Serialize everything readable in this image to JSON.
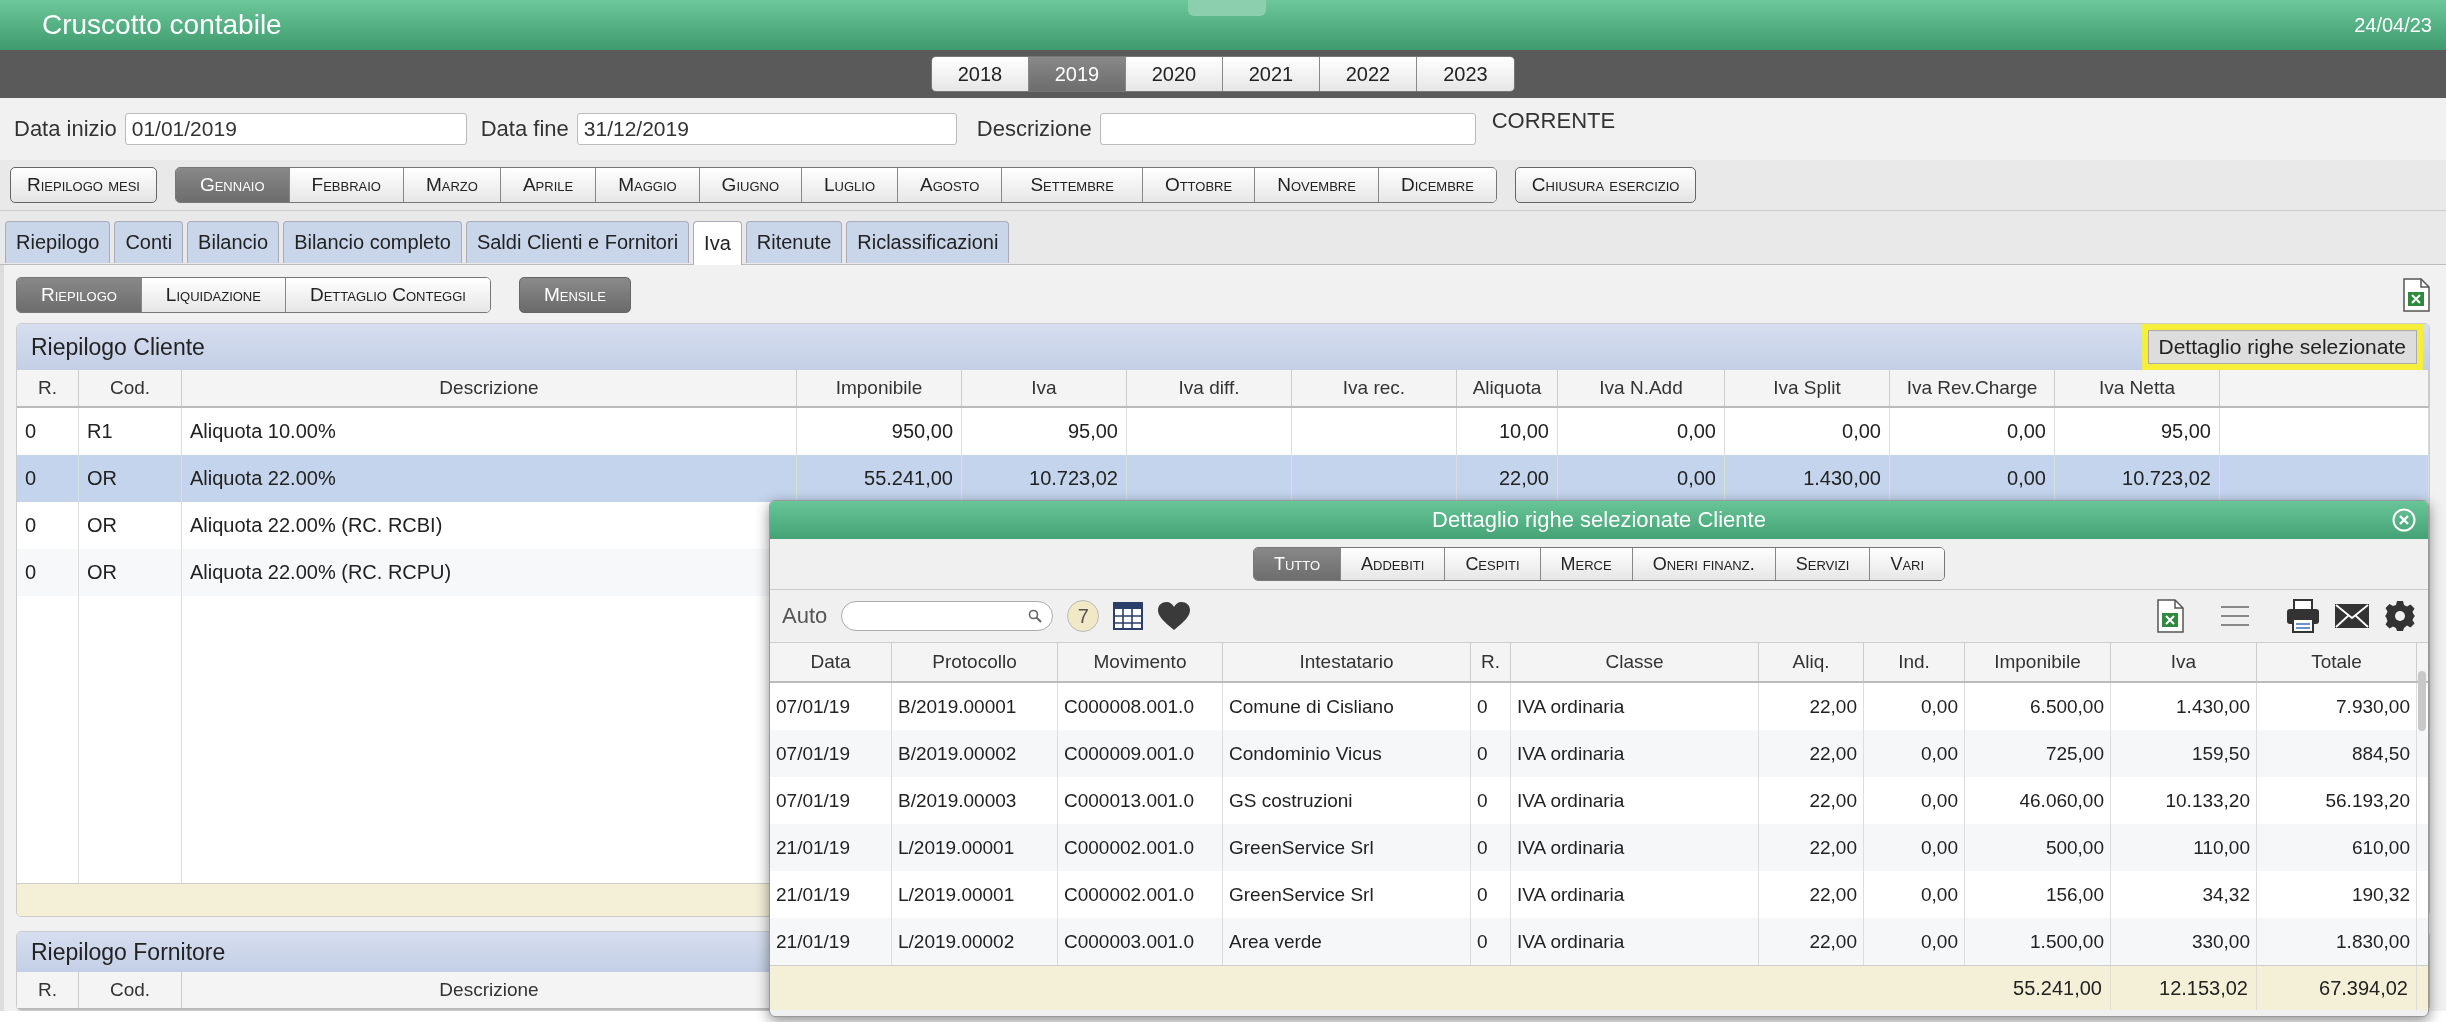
{
  "window": {
    "title": "Cruscotto contabile",
    "date": "24/04/23"
  },
  "years": [
    {
      "label": "2018",
      "selected": false
    },
    {
      "label": "2019",
      "selected": true
    },
    {
      "label": "2020",
      "selected": false
    },
    {
      "label": "2021",
      "selected": false
    },
    {
      "label": "2022",
      "selected": false
    },
    {
      "label": "2023",
      "selected": false
    }
  ],
  "period": {
    "start_label": "Data inizio",
    "start": "01/01/2019",
    "end_label": "Data fine",
    "end": "31/12/2019",
    "description_label": "Descrizione",
    "status": "CORRENTE"
  },
  "months": {
    "summary": "Riepilogo mesi",
    "items": [
      {
        "label": "Gennaio",
        "selected": true
      },
      {
        "label": "Febbraio",
        "selected": false
      },
      {
        "label": "Marzo",
        "selected": false
      },
      {
        "label": "Aprile",
        "selected": false
      },
      {
        "label": "Maggio",
        "selected": false
      },
      {
        "label": "Giugno",
        "selected": false
      },
      {
        "label": "Luglio",
        "selected": false
      },
      {
        "label": "Agosto",
        "selected": false
      },
      {
        "label": "Settembre",
        "selected": false
      },
      {
        "label": "Ottobre",
        "selected": false
      },
      {
        "label": "Novembre",
        "selected": false
      },
      {
        "label": "Dicembre",
        "selected": false
      }
    ],
    "closing": "Chiusura esercizio"
  },
  "tabs": [
    {
      "label": "Riepilogo",
      "selected": false
    },
    {
      "label": "Conti",
      "selected": false
    },
    {
      "label": "Bilancio",
      "selected": false
    },
    {
      "label": "Bilancio completo",
      "selected": false
    },
    {
      "label": "Saldi Clienti e Fornitori",
      "selected": false
    },
    {
      "label": "Iva",
      "selected": true
    },
    {
      "label": "Ritenute",
      "selected": false
    },
    {
      "label": "Riclassificazioni",
      "selected": false
    }
  ],
  "subtabs": [
    {
      "label": "Riepilogo",
      "selected": true
    },
    {
      "label": "Liquidazione",
      "selected": false
    },
    {
      "label": "Dettaglio Conteggi",
      "selected": false
    }
  ],
  "period_mode": {
    "label": "Mensile",
    "on": true
  },
  "customer_summary": {
    "title": "Riepilogo Cliente",
    "detail_button": {
      "label": "Dettaglio righe selezionate",
      "highlighted": true
    },
    "columns": [
      "R.",
      "Cod.",
      "Descrizione",
      "Imponibile",
      "Iva",
      "Iva diff.",
      "Iva rec.",
      "Aliquota",
      "Iva N.Add",
      "Iva Split",
      "Iva Rev.Charge",
      "Iva Netta"
    ],
    "rows": [
      {
        "selected": false,
        "cells": [
          "0",
          "R1",
          "Aliquota 10.00%",
          "950,00",
          "95,00",
          "",
          "",
          "10,00",
          "0,00",
          "0,00",
          "0,00",
          "95,00"
        ]
      },
      {
        "selected": true,
        "cells": [
          "0",
          "OR",
          "Aliquota 22.00%",
          "55.241,00",
          "10.723,02",
          "",
          "",
          "22,00",
          "0,00",
          "1.430,00",
          "0,00",
          "10.723,02"
        ]
      },
      {
        "selected": false,
        "cells": [
          "0",
          "OR",
          "Aliquota 22.00% (RC. RCBI)"
        ]
      },
      {
        "selected": false,
        "cells": [
          "0",
          "OR",
          "Aliquota 22.00% (RC. RCPU)"
        ]
      }
    ]
  },
  "supplier_summary": {
    "title": "Riepilogo Fornitore",
    "columns": [
      "R.",
      "Cod.",
      "Descrizione"
    ]
  },
  "detail_dialog": {
    "title": "Dettaglio righe selezionate Cliente",
    "filters": [
      {
        "label": "Tutto",
        "selected": true
      },
      {
        "label": "Addebiti",
        "selected": false
      },
      {
        "label": "Cespiti",
        "selected": false
      },
      {
        "label": "Merce",
        "selected": false
      },
      {
        "label": "Oneri finanz.",
        "selected": false
      },
      {
        "label": "Servizi",
        "selected": false
      },
      {
        "label": "Vari",
        "selected": false
      }
    ],
    "search_label": "Auto",
    "count": "7",
    "columns": [
      "Data",
      "Protocollo",
      "Movimento",
      "Intestatario",
      "R.",
      "Classe",
      "Aliq.",
      "Ind.",
      "Imponibile",
      "Iva",
      "Totale"
    ],
    "rows": [
      [
        "07/01/19",
        "B/2019.00001",
        "C000008.001.0",
        "Comune di Cisliano",
        "0",
        "IVA ordinaria",
        "22,00",
        "0,00",
        "6.500,00",
        "1.430,00",
        "7.930,00"
      ],
      [
        "07/01/19",
        "B/2019.00002",
        "C000009.001.0",
        "Condominio Vicus",
        "0",
        "IVA ordinaria",
        "22,00",
        "0,00",
        "725,00",
        "159,50",
        "884,50"
      ],
      [
        "07/01/19",
        "B/2019.00003",
        "C000013.001.0",
        "GS costruzioni",
        "0",
        "IVA ordinaria",
        "22,00",
        "0,00",
        "46.060,00",
        "10.133,20",
        "56.193,20"
      ],
      [
        "21/01/19",
        "L/2019.00001",
        "C000002.001.0",
        "GreenService Srl",
        "0",
        "IVA ordinaria",
        "22,00",
        "0,00",
        "500,00",
        "110,00",
        "610,00"
      ],
      [
        "21/01/19",
        "L/2019.00001",
        "C000002.001.0",
        "GreenService Srl",
        "0",
        "IVA ordinaria",
        "22,00",
        "0,00",
        "156,00",
        "34,32",
        "190,32"
      ],
      [
        "21/01/19",
        "L/2019.00002",
        "C000003.001.0",
        "Area verde",
        "0",
        "IVA ordinaria",
        "22,00",
        "0,00",
        "1.500,00",
        "330,00",
        "1.830,00"
      ]
    ],
    "totals": [
      "55.241,00",
      "12.153,02",
      "67.394,02"
    ]
  }
}
